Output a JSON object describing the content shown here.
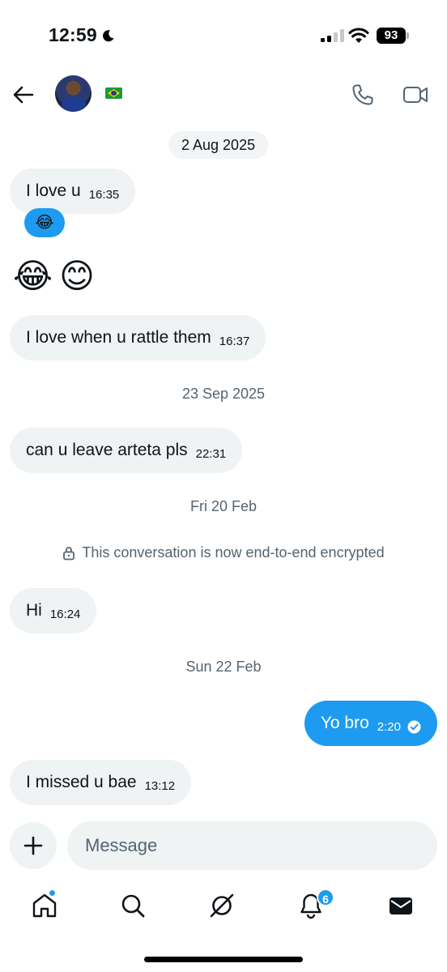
{
  "status_bar": {
    "time": "12:59",
    "battery": "93"
  },
  "header": {
    "contact_flag": "brazil-flag"
  },
  "conversation": {
    "dates": [
      "2 Aug 2025",
      "23 Sep 2025",
      "Fri 20 Feb",
      "Sun 22 Feb"
    ],
    "messages": [
      {
        "text": "I love u",
        "time": "16:35",
        "direction": "incoming"
      },
      {
        "text": "I love when u rattle them",
        "time": "16:37",
        "direction": "incoming"
      },
      {
        "text": "can u leave arteta pls",
        "time": "22:31",
        "direction": "incoming"
      },
      {
        "text": "Hi",
        "time": "16:24",
        "direction": "incoming"
      },
      {
        "text": "Yo bro",
        "time": "2:20",
        "direction": "outgoing",
        "status": "read"
      },
      {
        "text": "I missed u bae",
        "time": "13:12",
        "direction": "incoming"
      }
    ],
    "reaction": "😂",
    "emoji_message": [
      "😂",
      "😊"
    ],
    "encryption_notice": "This conversation is now end-to-end encrypted"
  },
  "composer": {
    "placeholder": "Message"
  },
  "tab_bar": {
    "items": [
      "home",
      "search",
      "grok",
      "notifications",
      "messages"
    ],
    "notification_count": "6"
  },
  "colors": {
    "accent": "#1d9bf0",
    "bubble": "#eff3f4",
    "secondary_text": "#536471"
  }
}
